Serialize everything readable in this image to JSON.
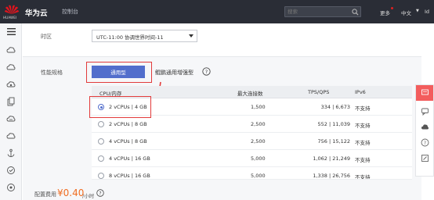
{
  "header": {
    "logo_text": "HUAWEI",
    "brand": "华为云",
    "console": "控制台",
    "search_placeholder": "搜索",
    "more": "更多",
    "language": "中文",
    "user": "Id"
  },
  "zone": {
    "label": "时区",
    "value": "UTC-11:00 协调世界时间-11"
  },
  "performance": {
    "label": "性能规格",
    "active_type": "通用型",
    "other_type": "鲲鹏通用增强型"
  },
  "table": {
    "headers": [
      "CPU/内存",
      "最大连接数",
      "TPS/QPS",
      "IPv6"
    ],
    "rows": [
      {
        "spec": "2 vCPUs | 4 GB",
        "conn": "1,500",
        "tps": "334 | 6,673",
        "ipv6": "不支持",
        "selected": true
      },
      {
        "spec": "2 vCPUs | 8 GB",
        "conn": "2,500",
        "tps": "552 | 11,039",
        "ipv6": "不支持",
        "selected": false
      },
      {
        "spec": "4 vCPUs | 8 GB",
        "conn": "2,500",
        "tps": "756 | 15,122",
        "ipv6": "不支持",
        "selected": false
      },
      {
        "spec": "4 vCPUs | 16 GB",
        "conn": "5,000",
        "tps": "1,062 | 21,249",
        "ipv6": "不支持",
        "selected": false
      },
      {
        "spec": "8 vCPUs | 16 GB",
        "conn": "5,000",
        "tps": "1,338 | 26,756",
        "ipv6": "不支持",
        "selected": false
      }
    ]
  },
  "price": {
    "label": "配置费用",
    "value": "¥0.40",
    "unit": "/小时"
  },
  "colors": {
    "topbar": "#2a2d36",
    "accent": "#526ecc",
    "highlight": "#e23b3b",
    "price": "#f06d22"
  }
}
